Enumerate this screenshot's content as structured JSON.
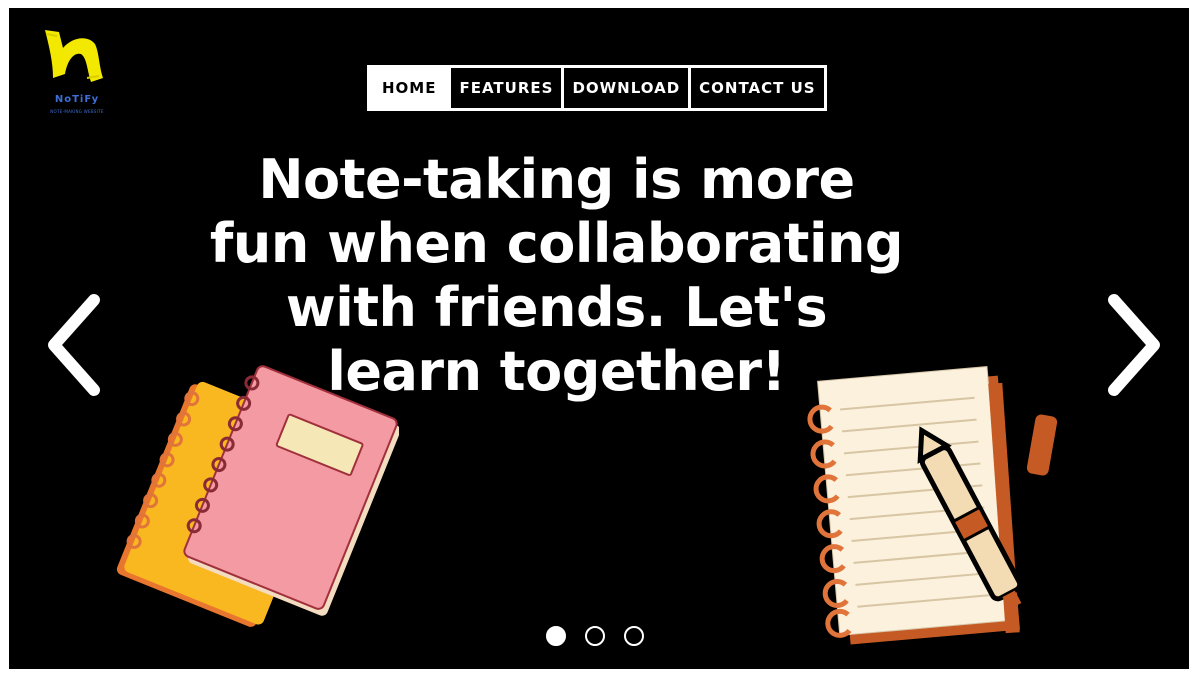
{
  "logo": {
    "name": "NoTiFy",
    "tagline": "NOTE-MAKING WEBSITE",
    "icon": "notify-n-logo",
    "color": "#f2e800"
  },
  "nav": {
    "items": [
      {
        "label": "HOME",
        "active": true
      },
      {
        "label": "FEATURES",
        "active": false
      },
      {
        "label": "DOWNLOAD",
        "active": false
      },
      {
        "label": "CONTACT US",
        "active": false
      }
    ]
  },
  "hero": {
    "headline": "Note-taking is more fun when collaborating with friends. Let's learn together!"
  },
  "carousel": {
    "prev_icon": "chevron-left-icon",
    "next_icon": "chevron-right-icon",
    "slide_count": 3,
    "active_slide": 1
  },
  "colors": {
    "background": "#000000",
    "text": "#ffffff",
    "notebook_pink": "#f39aa2",
    "notebook_yellow": "#f9b820",
    "spiral_orange": "#e0743a",
    "paper": "#fbf1dc"
  }
}
